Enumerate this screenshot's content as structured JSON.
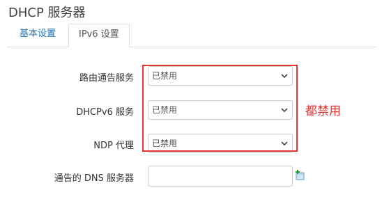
{
  "page": {
    "title": "DHCP 服务器"
  },
  "tabs": [
    {
      "label": "基本设置",
      "active": false
    },
    {
      "label": "IPv6 设置",
      "active": true
    }
  ],
  "fields": {
    "ra": {
      "label": "路由通告服务",
      "value": "已禁用"
    },
    "dhcpv6": {
      "label": "DHCPv6 服务",
      "value": "已禁用"
    },
    "ndp": {
      "label": "NDP 代理",
      "value": "已禁用"
    },
    "dns": {
      "label": "通告的 DNS 服务器",
      "value": ""
    }
  },
  "annotation": {
    "text": "都禁用",
    "color": "#e53333"
  },
  "icons": {
    "select_arrow": "chevron-down-icon",
    "add": "add-icon"
  }
}
